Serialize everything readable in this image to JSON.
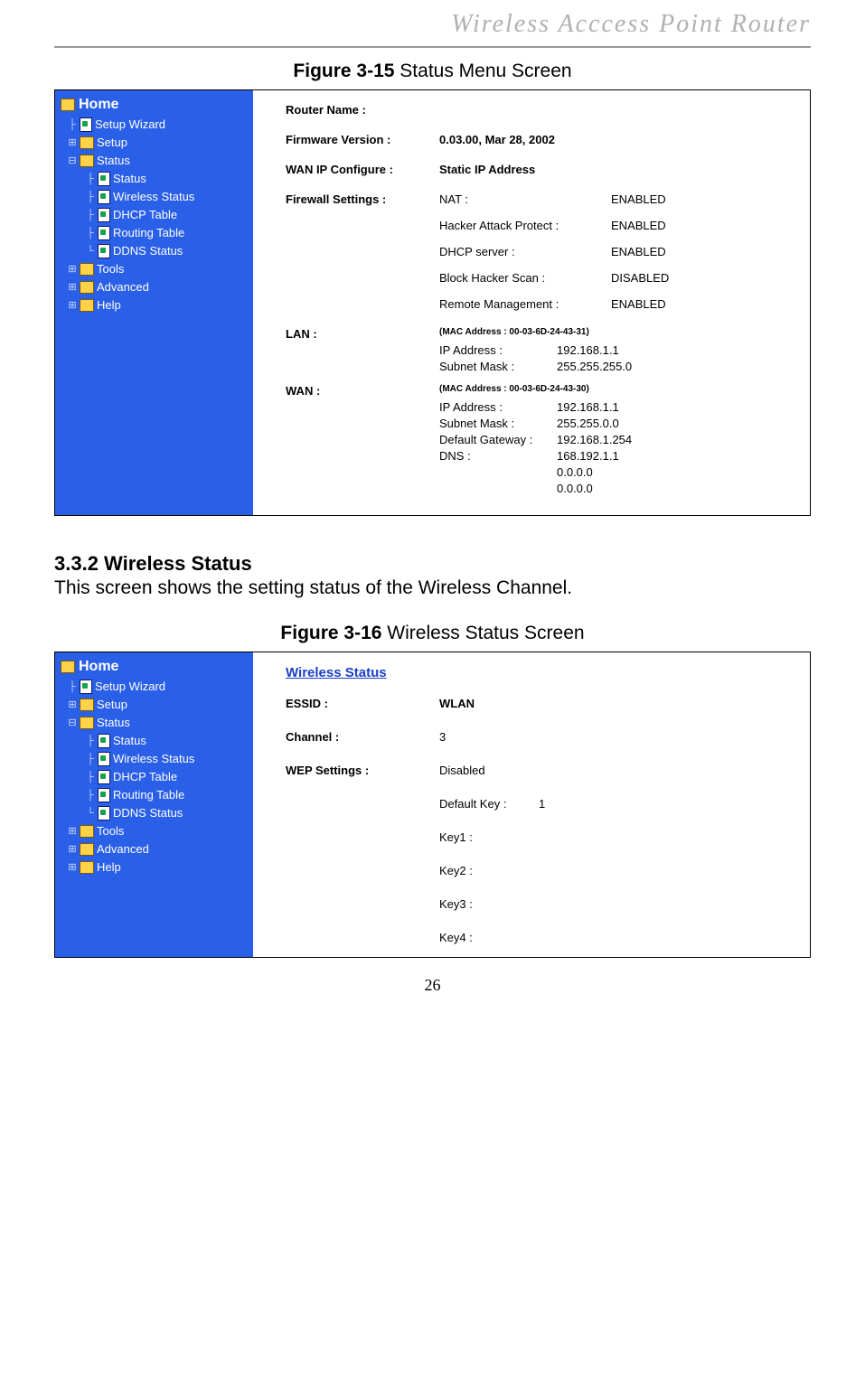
{
  "header": "Wireless  Acccess  Point  Router",
  "caption1_bold": "Figure 3-15",
  "caption1_rest": " Status Menu Screen",
  "nav": {
    "home": "Home",
    "setup_wizard": "Setup Wizard",
    "setup": "Setup",
    "status": "Status",
    "status_children": {
      "status": "Status",
      "wireless_status": "Wireless Status",
      "dhcp_table": "DHCP Table",
      "routing_table": "Routing Table",
      "ddns_status": "DDNS Status"
    },
    "tools": "Tools",
    "advanced": "Advanced",
    "help": "Help"
  },
  "status_content": {
    "router_name_label": "Router Name :",
    "router_name_value": "",
    "fw_label": "Firmware Version :",
    "fw_value": "0.03.00, Mar 28, 2002",
    "wan_cfg_label": "WAN IP Configure :",
    "wan_cfg_value": "Static IP Address",
    "firewall_label": "Firewall Settings :",
    "fw_items": [
      {
        "k": "NAT :",
        "v": "ENABLED"
      },
      {
        "k": "Hacker Attack Protect :",
        "v": "ENABLED"
      },
      {
        "k": "DHCP server :",
        "v": "ENABLED"
      },
      {
        "k": "Block Hacker Scan :",
        "v": "DISABLED"
      },
      {
        "k": "Remote Management :",
        "v": "ENABLED"
      }
    ],
    "lan_label": "LAN :",
    "lan_mac": "(MAC Address : 00-03-6D-24-43-31)",
    "lan_rows": [
      {
        "k": "IP Address :",
        "v": "192.168.1.1"
      },
      {
        "k": "Subnet Mask :",
        "v": "255.255.255.0"
      }
    ],
    "wan_label": "WAN :",
    "wan_mac": "(MAC Address : 00-03-6D-24-43-30)",
    "wan_rows": [
      {
        "k": "IP Address :",
        "v": "192.168.1.1"
      },
      {
        "k": "Subnet Mask :",
        "v": "255.255.0.0"
      },
      {
        "k": "Default Gateway :",
        "v": "192.168.1.254"
      },
      {
        "k": "DNS :",
        "v": "168.192.1.1"
      },
      {
        "k": "",
        "v": "0.0.0.0"
      },
      {
        "k": "",
        "v": "0.0.0.0"
      }
    ]
  },
  "section_heading": "3.3.2 Wireless Status",
  "section_body": "This screen shows the setting status of the Wireless Channel.",
  "caption2_bold": "Figure 3-16",
  "caption2_rest": " Wireless Status Screen",
  "wireless_content": {
    "title": "Wireless Status",
    "essid_label": "ESSID :",
    "essid_value": "WLAN",
    "channel_label": "Channel :",
    "channel_value": "3",
    "wep_label": "WEP Settings :",
    "wep_value": "Disabled",
    "default_key_label": "Default Key :",
    "default_key_value": "1",
    "key1": "Key1 :",
    "key2": "Key2 :",
    "key3": "Key3 :",
    "key4": "Key4 :"
  },
  "page_number": "26"
}
